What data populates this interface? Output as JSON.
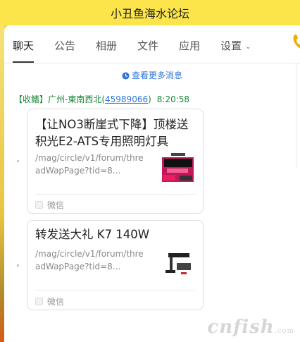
{
  "window": {
    "title": "小丑鱼海水论坛"
  },
  "tabs": [
    {
      "label": "聊天"
    },
    {
      "label": "公告"
    },
    {
      "label": "相册"
    },
    {
      "label": "文件"
    },
    {
      "label": "应用"
    },
    {
      "label": "设置"
    }
  ],
  "chat": {
    "more_messages": "查看更多消息",
    "sender": {
      "prefix": "【收鳍】广州-東南西北(",
      "qq": "45989066",
      "suffix": ")",
      "time": "8:20:58"
    },
    "messages": [
      {
        "title": "【让NO3断崖式下降】顶楼送积光E2-ATS专用照明灯具",
        "url": "/mag/circle/v1/forum/threadWapPage?tid=8...",
        "source": "微信",
        "thumb_icon": "product-image-pink"
      },
      {
        "title": "转发送大礼 K7 140W",
        "url": "/mag/circle/v1/forum/threadWapPage?tid=8...",
        "source": "微信",
        "thumb_icon": "product-image-lamp"
      }
    ]
  },
  "watermark": {
    "text": "cnfish",
    "suffix": ".com"
  },
  "colors": {
    "title_bar": "#fbe54a",
    "link_blue": "#2f78d6",
    "sender_green": "#1a8a3a"
  }
}
